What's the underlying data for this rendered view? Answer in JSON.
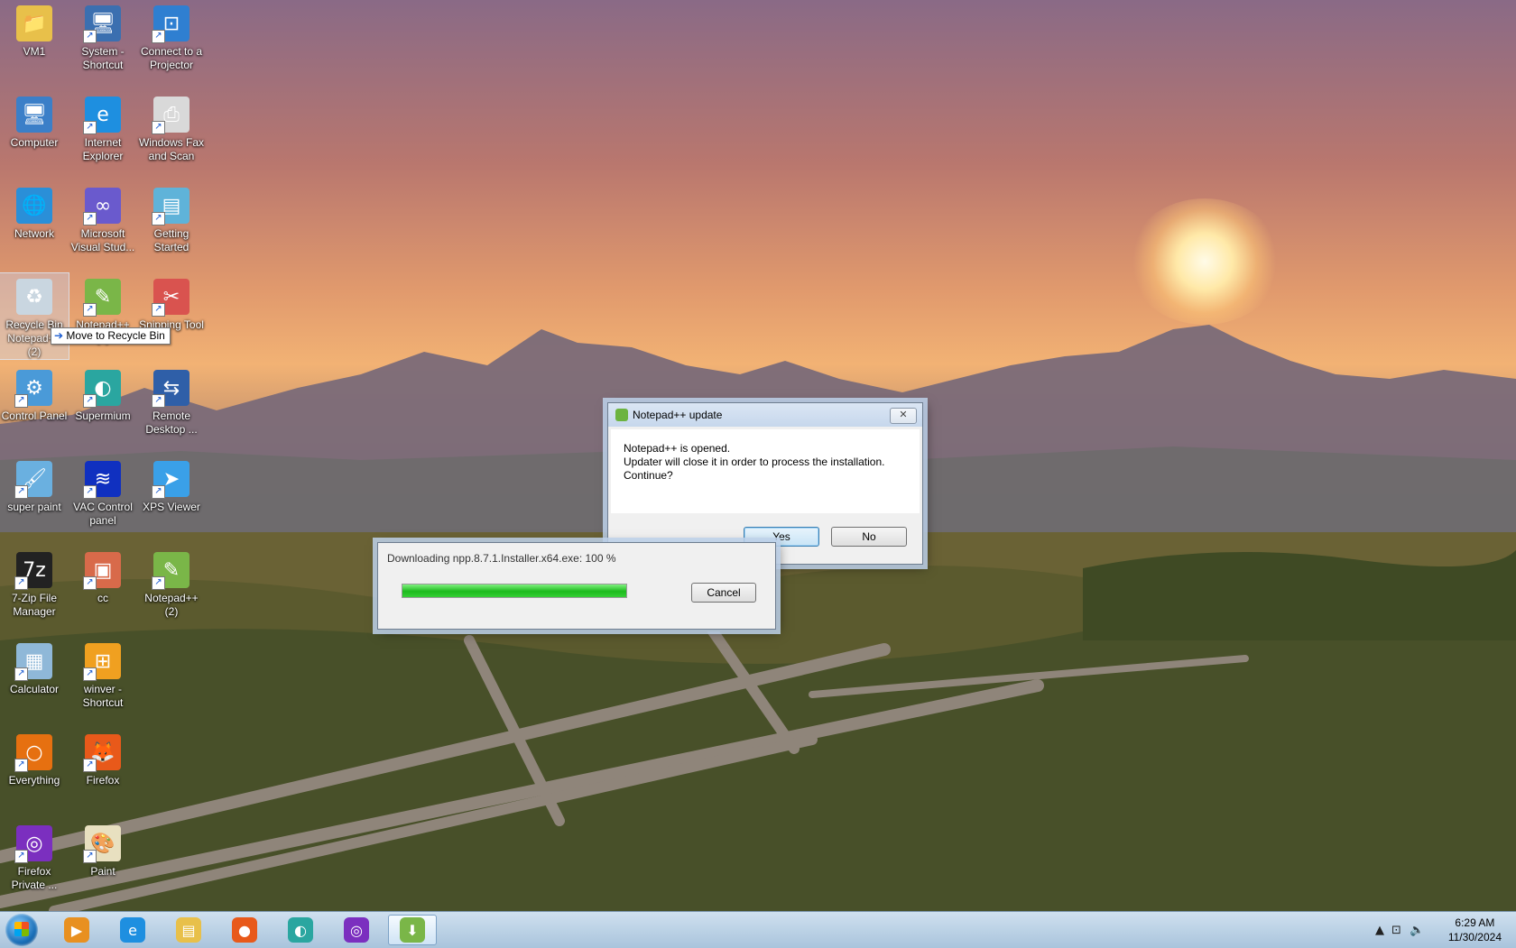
{
  "desktop": {
    "icons": [
      {
        "label": "VM1",
        "icon": "folder-user-icon"
      },
      {
        "label": "System - Shortcut",
        "icon": "system-monitor-icon"
      },
      {
        "label": "Connect to a Projector",
        "icon": "projector-icon"
      },
      {
        "label": "Computer",
        "icon": "computer-icon"
      },
      {
        "label": "Internet Explorer",
        "icon": "internet-explorer-icon"
      },
      {
        "label": "Windows Fax and Scan",
        "icon": "fax-scanner-icon"
      },
      {
        "label": "Network",
        "icon": "network-globe-icon"
      },
      {
        "label": "Microsoft Visual Stud...",
        "icon": "visual-studio-icon"
      },
      {
        "label": "Getting Started",
        "icon": "getting-started-icon"
      },
      {
        "label": "Recycle Bin",
        "icon": "recycle-bin-icon"
      },
      {
        "label": "Notepad++ (2)",
        "icon": "notepad-plus-plus-icon"
      },
      {
        "label": "Snipping Tool",
        "icon": "scissors-icon"
      },
      {
        "label": "Control Panel",
        "icon": "control-panel-icon"
      },
      {
        "label": "Supermium",
        "icon": "supermium-icon"
      },
      {
        "label": "Remote Desktop ...",
        "icon": "remote-desktop-icon"
      },
      {
        "label": "super paint",
        "icon": "paint-icon"
      },
      {
        "label": "VAC Control panel",
        "icon": "vac-panel-icon"
      },
      {
        "label": "XPS Viewer",
        "icon": "xps-viewer-icon"
      },
      {
        "label": "7-Zip File Manager",
        "icon": "seven-zip-icon"
      },
      {
        "label": "cc",
        "icon": "image-icon"
      },
      {
        "label": "Notepad++ (2)",
        "icon": "notepad-plus-plus-icon"
      },
      {
        "label": "Calculator",
        "icon": "calculator-icon"
      },
      {
        "label": "winver - Shortcut",
        "icon": "windows-logo-icon"
      },
      {
        "label": "Everything",
        "icon": "everything-search-icon"
      },
      {
        "label": "Firefox",
        "icon": "firefox-icon"
      },
      {
        "label": "Firefox Private ...",
        "icon": "firefox-private-icon"
      },
      {
        "label": "Paint",
        "icon": "paint-palette-icon"
      }
    ],
    "drag_overlay_label": "Notepad++ (2)",
    "tooltip": "Move to Recycle Bin"
  },
  "update_dialog": {
    "title": "Notepad++ update",
    "message_line1": "Notepad++ is opened.",
    "message_line2": "Updater will close it in order to process the installation.",
    "message_line3": "Continue?",
    "yes_label": "Yes",
    "no_label": "No",
    "close_symbol": "✕"
  },
  "download_dialog": {
    "title": "Downloading npp.8.7.1.Installer.x64.exe: 100 %",
    "progress": 1.0,
    "cancel_label": "Cancel"
  },
  "taskbar": {
    "items": [
      {
        "icon": "media-player-icon"
      },
      {
        "icon": "internet-explorer-icon"
      },
      {
        "icon": "file-explorer-icon"
      },
      {
        "icon": "firefox-icon"
      },
      {
        "icon": "supermium-icon"
      },
      {
        "icon": "firefox-private-icon"
      },
      {
        "icon": "notepad-plus-plus-updater-icon"
      }
    ],
    "time": "6:29 AM",
    "date": "11/30/2024"
  },
  "colors": {
    "progress_fill": "#1dbb1d",
    "taskbar_bg": "#bcd3e8",
    "dialog_bg": "#f0f0f0"
  }
}
